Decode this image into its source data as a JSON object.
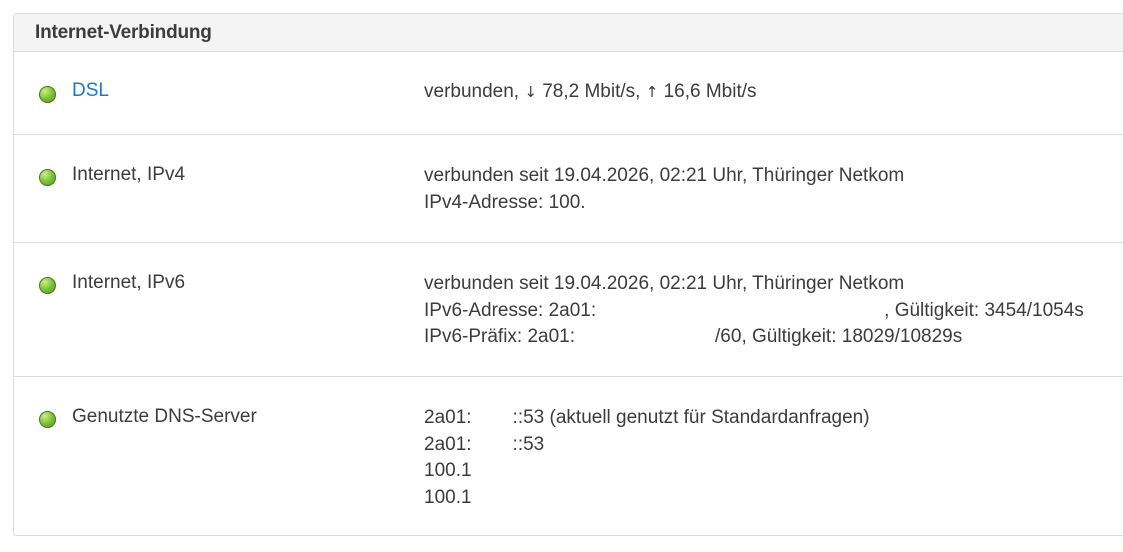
{
  "panel": {
    "title": "Internet-Verbindung"
  },
  "rows": {
    "dsl": {
      "label": "DSL",
      "value_prefix": "verbunden, ",
      "down_arrow": "↓",
      "down_rate": " 78,2 Mbit/s, ",
      "up_arrow": "↑",
      "up_rate": " 16,6 Mbit/s"
    },
    "ipv4": {
      "label": "Internet, IPv4",
      "line1": "verbunden seit 19.04.2026, 02:21 Uhr, Thüringer Netkom",
      "line2": "IPv4-Adresse: 100."
    },
    "ipv6": {
      "label": "Internet, IPv6",
      "line1": "verbunden seit 19.04.2026, 02:21 Uhr, Thüringer Netkom",
      "address_prefix": "IPv6-Adresse: 2a01:",
      "address_suffix": ", Gültigkeit: 3454/1054s",
      "prefix_prefix": "IPv6-Präfix: 2a01:",
      "prefix_suffix": "/60, Gültigkeit: 18029/10829s"
    },
    "dns": {
      "label": "Genutzte DNS-Server",
      "server1_a": "2a01:",
      "server1_b": "::53 (aktuell genutzt für Standardanfragen)",
      "server2_a": "2a01:",
      "server2_b": "::53",
      "server3": "100.1",
      "server4": "100.1"
    }
  },
  "colors": {
    "status_led": "#7fc23a",
    "link": "#1b76c6",
    "header_bg": "#f4f4f4",
    "border": "#dcdcdc"
  },
  "icons": {
    "status": "green-status-led-icon"
  }
}
